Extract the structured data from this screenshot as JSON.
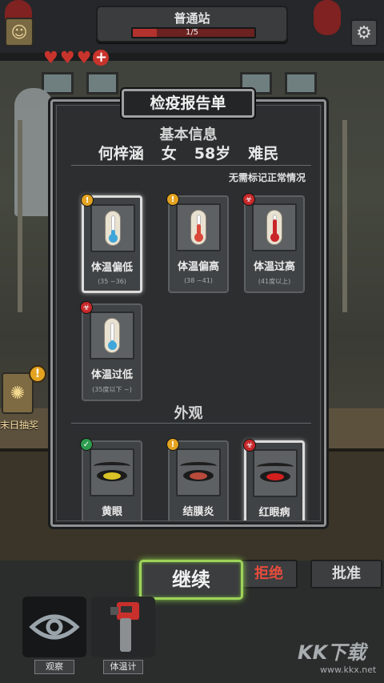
{
  "header": {
    "station_name": "普通站",
    "progress_text": "1/5",
    "progress_fraction": 0.2,
    "hearts_filled": 3,
    "heart_add_symbol": "+"
  },
  "lottery": {
    "label": "末日抽奖",
    "badge": "!"
  },
  "panel": {
    "title": "检疫报告单",
    "basic_info_title": "基本信息",
    "person": {
      "name": "何梓涵",
      "gender": "女",
      "age": "58岁",
      "identity": "难民"
    },
    "note": "无需标记正常情况",
    "appearance_title": "外观",
    "temperature_cards": [
      {
        "label": "体温偏低",
        "range": "(35 ~36)",
        "badge": "warn",
        "badge_symbol": "!",
        "mercury_color": "#3fa6d9",
        "mercury_level": 0.3,
        "selected": true
      },
      {
        "label": "体温偏高",
        "range": "(38 ~41)",
        "badge": "warn",
        "badge_symbol": "!",
        "mercury_color": "#d94a3a",
        "mercury_level": 0.6,
        "selected": false
      },
      {
        "label": "体温过高",
        "range": "(41度以上)",
        "badge": "danger",
        "badge_symbol": "☣",
        "mercury_color": "#c9262a",
        "mercury_level": 0.85,
        "selected": false
      },
      {
        "label": "体温过低",
        "range": "(35度以下 ~)",
        "badge": "danger",
        "badge_symbol": "☣",
        "mercury_color": "#3fa6d9",
        "mercury_level": 0.15,
        "selected": false
      }
    ],
    "eye_cards": [
      {
        "label": "黄眼",
        "badge": "ok",
        "badge_symbol": "✓",
        "iris_color": "#d9c227",
        "selected": false
      },
      {
        "label": "结膜炎",
        "badge": "warn",
        "badge_symbol": "!",
        "iris_color": "#b84a3c",
        "selected": false
      },
      {
        "label": "红眼病",
        "badge": "danger",
        "badge_symbol": "☣",
        "iris_color": "#d3201f",
        "selected": true
      }
    ]
  },
  "actions": {
    "continue": "继续",
    "reject": "拒绝",
    "approve": "批准"
  },
  "tools": [
    {
      "label": "观察",
      "icon": "eye-icon"
    },
    {
      "label": "体温计",
      "icon": "thermometer-gun-icon"
    }
  ],
  "watermark": {
    "brand": "KK下载",
    "url": "www.kkx.net"
  },
  "colors": {
    "accent_green": "#9ed35a",
    "danger_red": "#c7282a",
    "warn_orange": "#e3a321",
    "ok_green": "#2d9c4e"
  }
}
